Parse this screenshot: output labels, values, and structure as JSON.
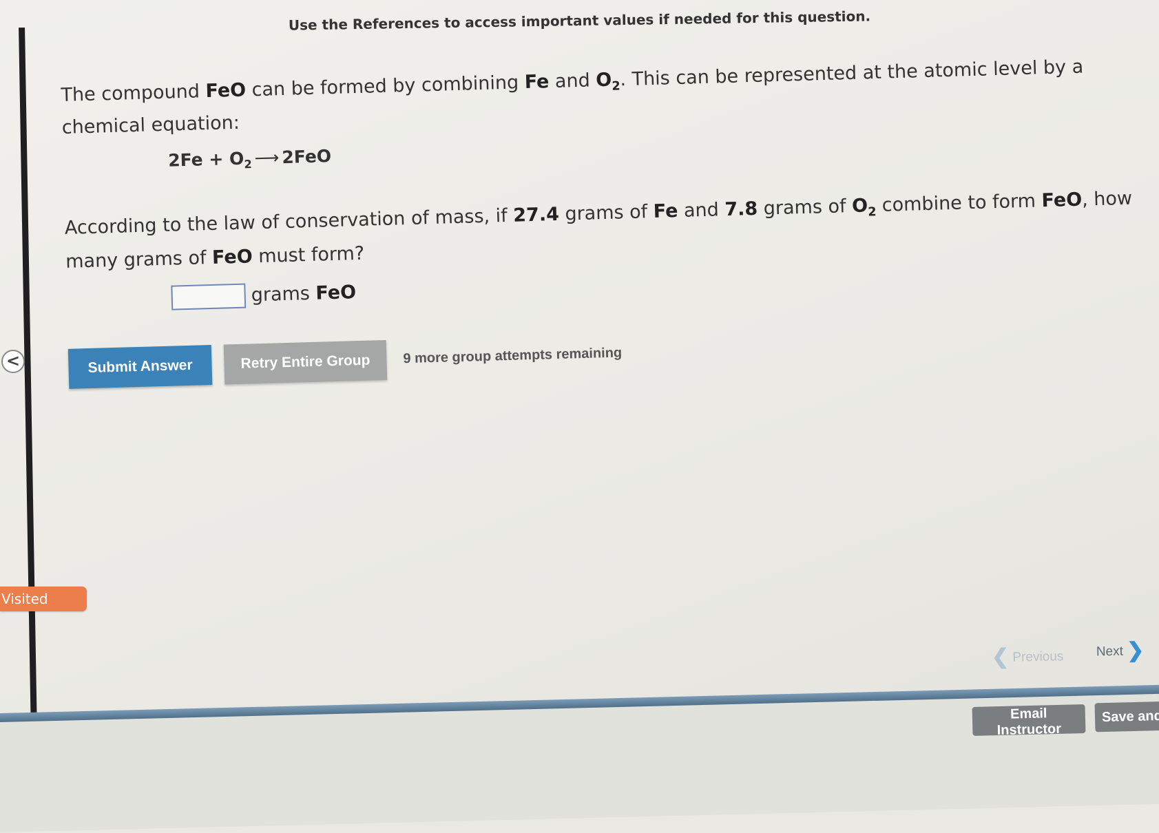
{
  "header": {
    "references_note": "Use the References to access important values if needed for this question."
  },
  "question": {
    "intro_pre": "The compound ",
    "compound": "FeO",
    "intro_mid1": " can be formed by combining ",
    "element": "Fe",
    "intro_mid2": " and ",
    "o2_base": "O",
    "o2_sub": "2",
    "intro_post": ". This can be represented at the atomic level by a chemical equation:",
    "equation": {
      "lhs_fe": "2Fe",
      "plus": "+",
      "o2_base": "O",
      "o2_sub": "2",
      "arrow": "⟶",
      "rhs": "2FeO"
    },
    "prompt_pre": "According to the law of conservation of mass, if ",
    "fe_mass": "27.4",
    "prompt_mid1": " grams of ",
    "prompt_mid2": " and ",
    "o2_mass": "7.8",
    "prompt_mid3": " grams of ",
    "prompt_mid4": " combine to form ",
    "prompt_mid5": ", how many grams of ",
    "prompt_end": " must form?"
  },
  "answer": {
    "value": "",
    "units_text": "grams ",
    "units_compound": "FeO"
  },
  "actions": {
    "submit_label": "Submit Answer",
    "retry_label": "Retry Entire Group",
    "attempts_text": "9 more group attempts remaining"
  },
  "sidebar": {
    "collapse_glyph": "<",
    "visited_label": "Visited"
  },
  "navigation": {
    "previous_label": "Previous",
    "next_label": "Next",
    "prev_chevron": "❮",
    "next_chevron": "❯"
  },
  "footer": {
    "email_label": "Email Instructor",
    "save_label": "Save and"
  },
  "colors": {
    "submit_button": "#3b82b8",
    "retry_button": "#a5a6a6",
    "visited_tab": "#ec7e4c",
    "footer_band": "#5f7f9b"
  }
}
